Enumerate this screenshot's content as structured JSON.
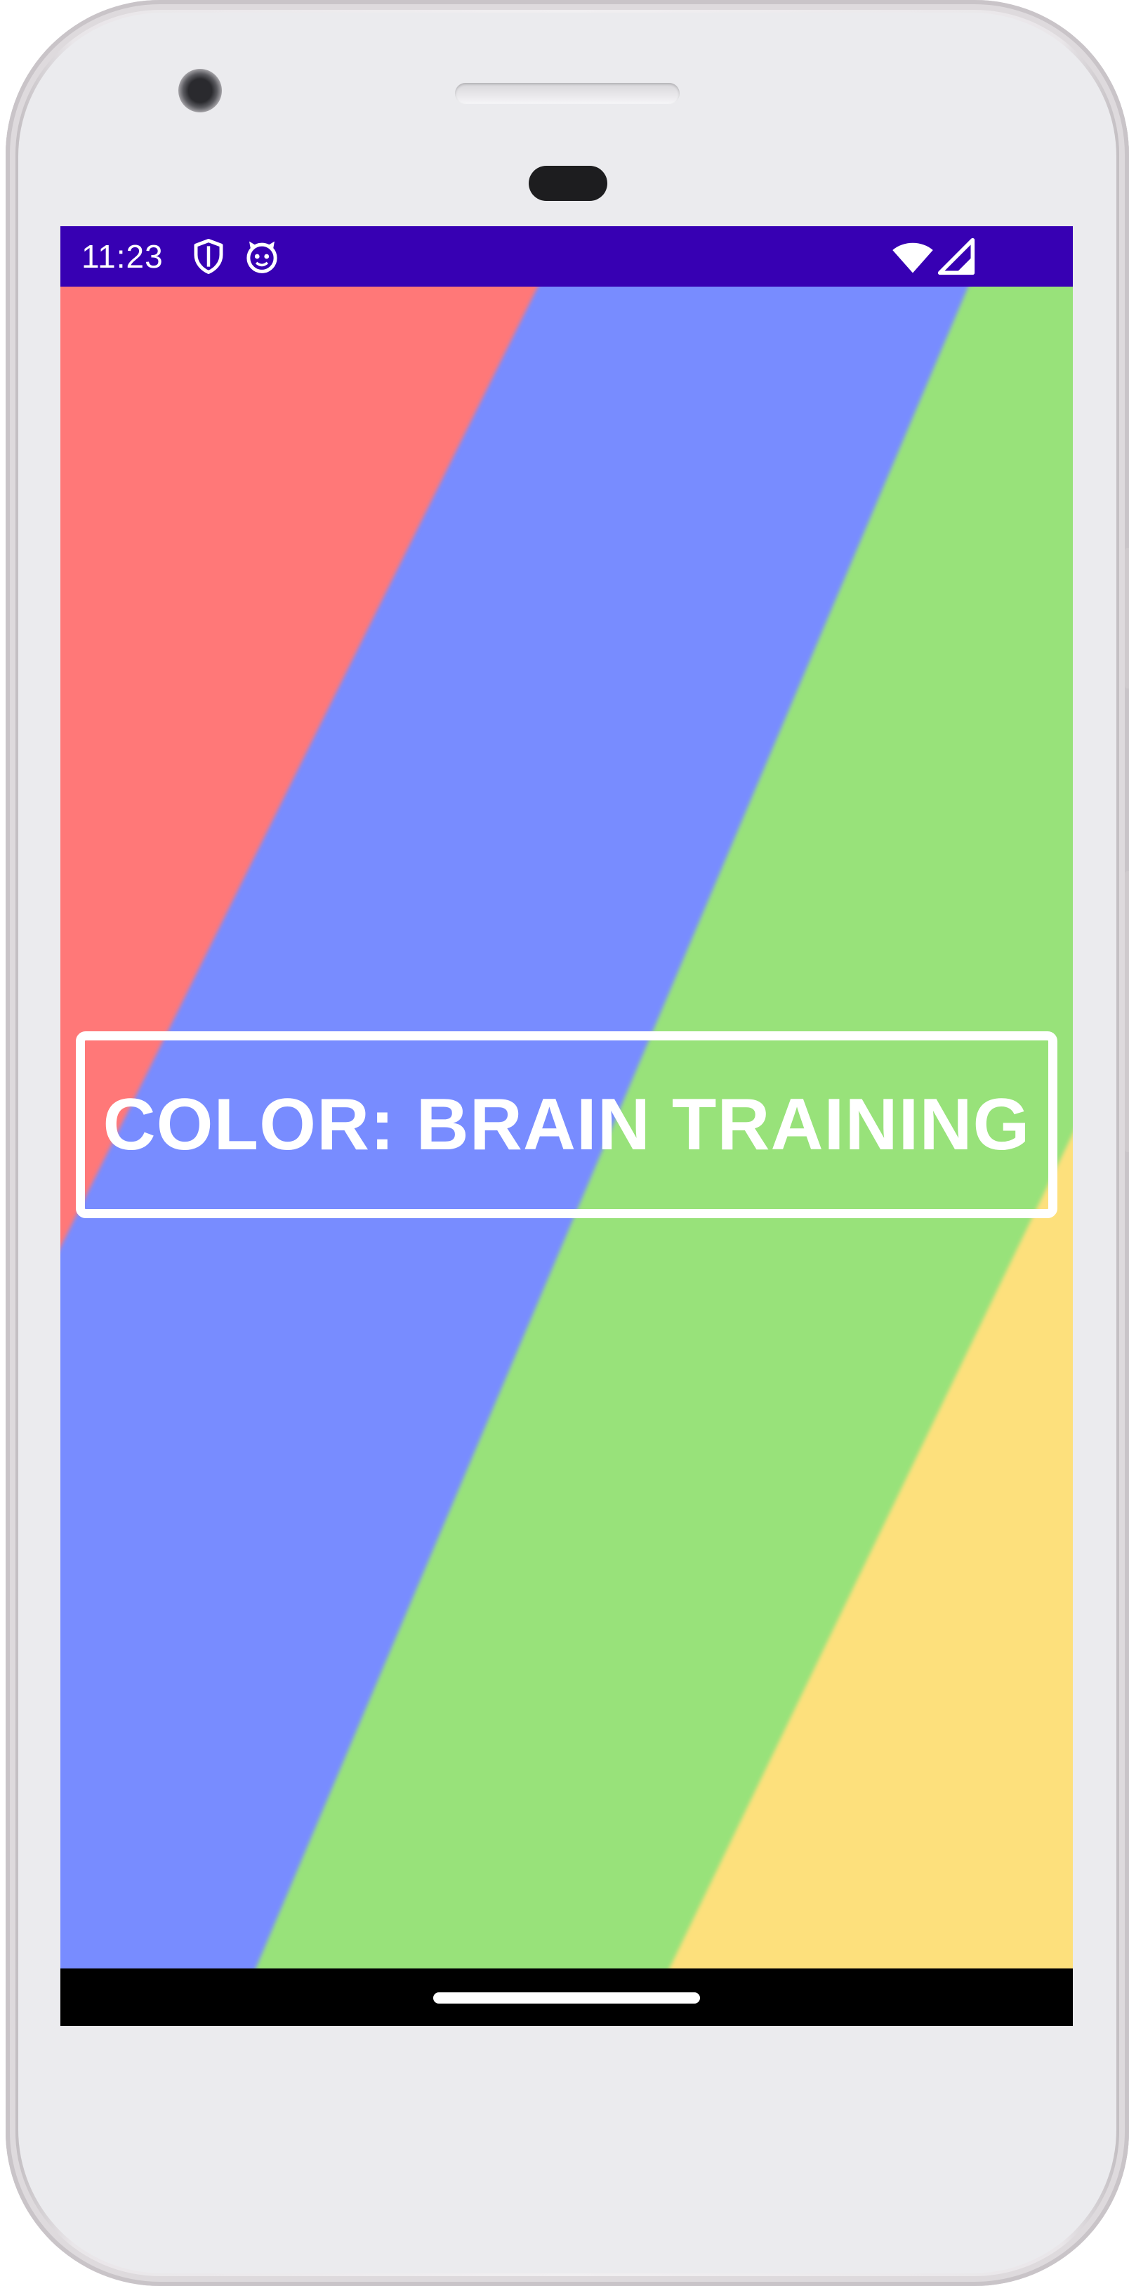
{
  "device": {
    "model": "android-phone"
  },
  "status_bar": {
    "time": "11:23",
    "background_color": "#3700b3",
    "left_icons": [
      "shield-icon",
      "cat-face-icon"
    ],
    "right_icons": [
      "wifi-icon",
      "cellular-signal-icon"
    ]
  },
  "app": {
    "title": "COLOR: BRAIN TRAINING",
    "stripe_colors": {
      "red": "#ff7878",
      "blue": "#788cff",
      "green": "#98e27a",
      "yellow": "#fde07c"
    }
  },
  "navigation": {
    "type": "gesture",
    "home_handle": "home-handle"
  }
}
